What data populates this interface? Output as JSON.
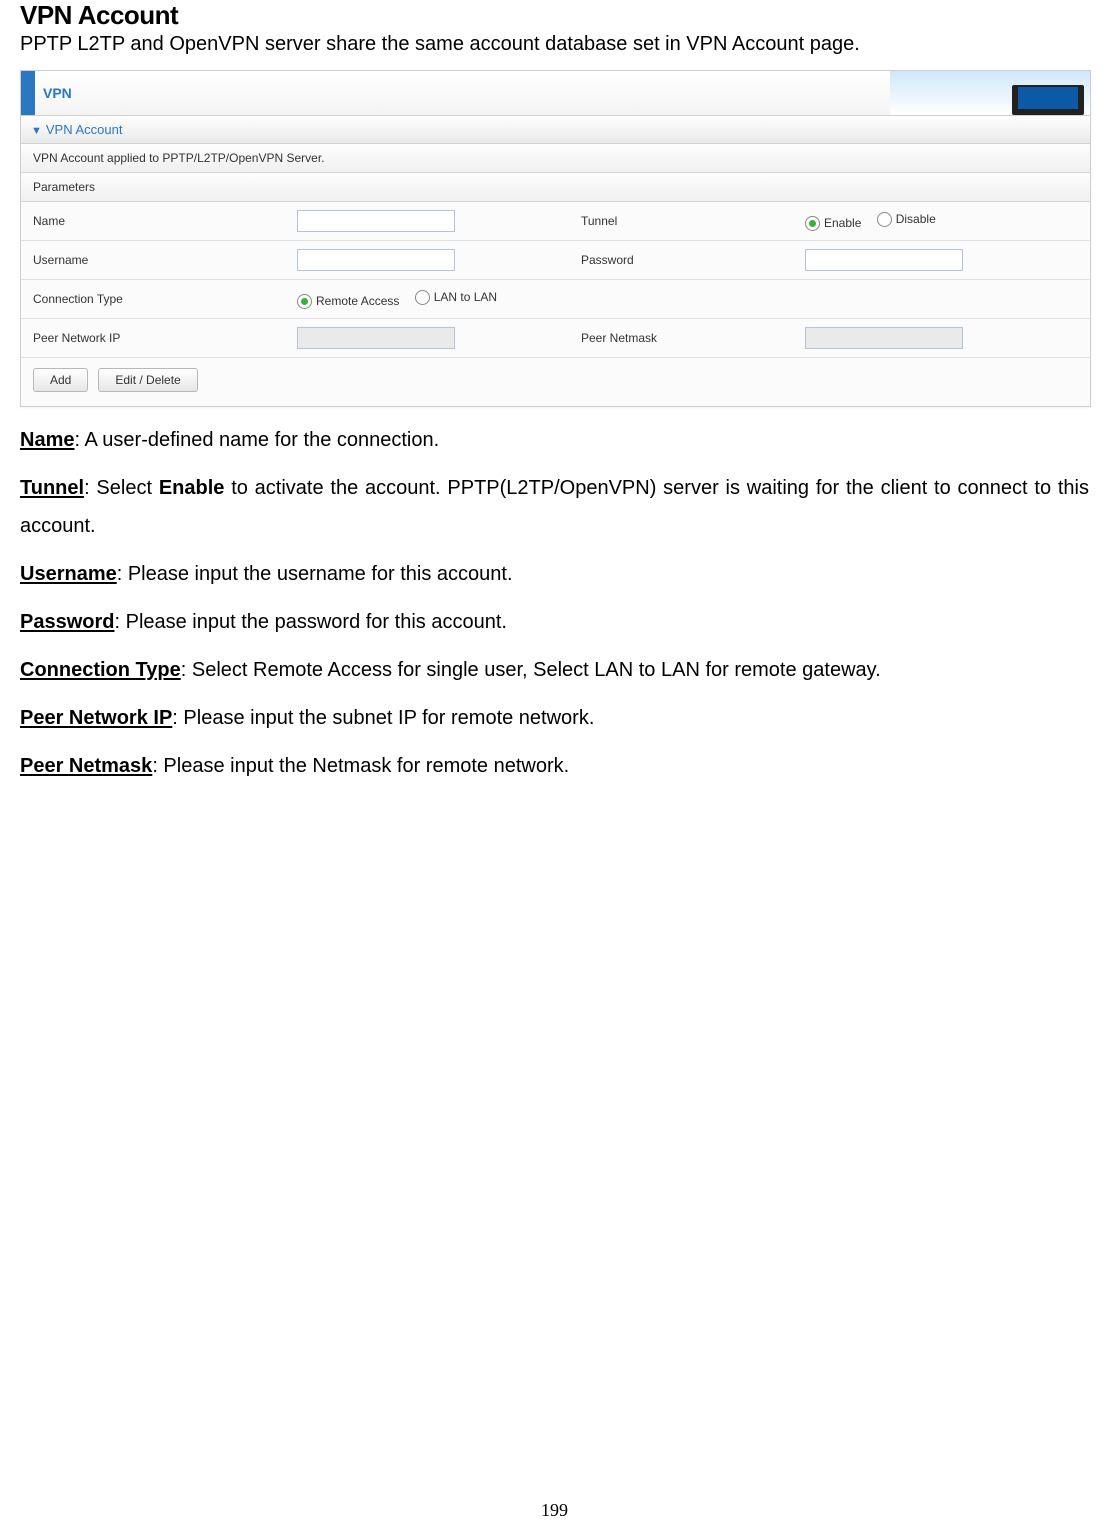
{
  "page": {
    "title": "VPN Account",
    "subtitle": "PPTP L2TP and OpenVPN server share the same account database set in VPN Account page.",
    "number": "199"
  },
  "vpn_panel": {
    "header": "VPN",
    "section": "VPN Account",
    "description": "VPN Account applied to PPTP/L2TP/OpenVPN Server.",
    "params_label": "Parameters",
    "labels": {
      "name": "Name",
      "tunnel": "Tunnel",
      "enable": "Enable",
      "disable": "Disable",
      "username": "Username",
      "password": "Password",
      "connection_type": "Connection Type",
      "remote_access": "Remote Access",
      "lan_to_lan": "LAN to LAN",
      "peer_network_ip": "Peer Network IP",
      "peer_netmask": "Peer Netmask"
    },
    "buttons": {
      "add": "Add",
      "edit_delete": "Edit / Delete"
    }
  },
  "definitions": {
    "name_term": "Name",
    "name_text": ": A user-defined name for the connection.",
    "tunnel_term": "Tunnel",
    "tunnel_text_a": ": Select ",
    "tunnel_bold": "Enable",
    "tunnel_text_b": " to activate the account. PPTP(L2TP/OpenVPN) server is waiting for the client to connect to this account.",
    "username_term": "Username",
    "username_text": ": Please input the username for this account.",
    "password_term": "Password",
    "password_text": ": Please input the password for this account.",
    "conn_term": "Connection Type",
    "conn_text": ": Select Remote Access for single user, Select LAN to LAN for remote gateway.",
    "peerip_term": "Peer Network IP",
    "peerip_text": ": Please input the subnet IP for remote network.",
    "peernm_term": "Peer Netmask",
    "peernm_text": ": Please input the Netmask for remote network."
  }
}
